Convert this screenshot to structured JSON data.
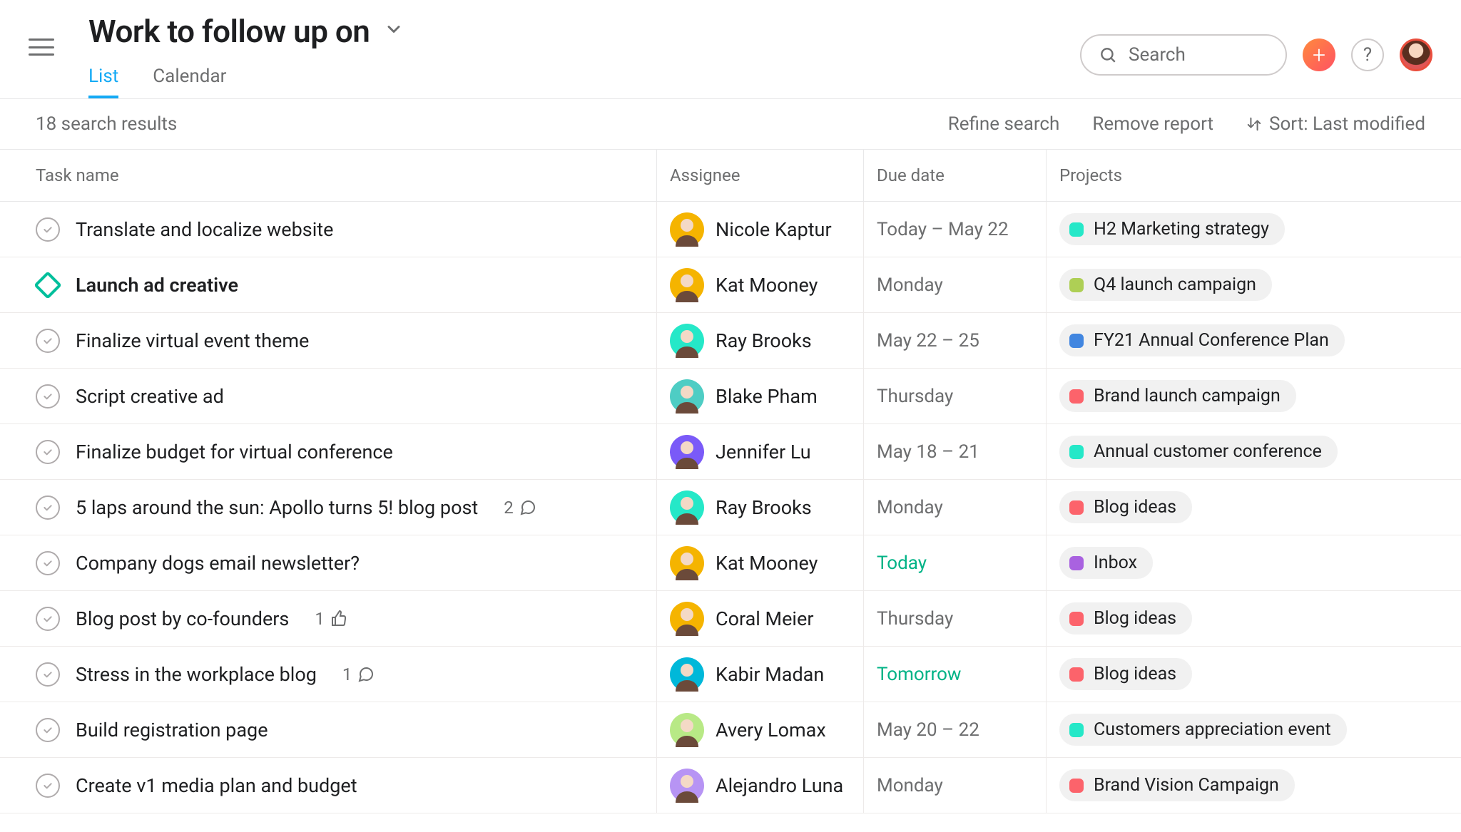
{
  "header": {
    "title": "Work to follow up on",
    "tabs": [
      {
        "label": "List",
        "active": true
      },
      {
        "label": "Calendar",
        "active": false
      }
    ],
    "search_placeholder": "Search"
  },
  "toolbar": {
    "result_count": "18 search results",
    "refine": "Refine search",
    "remove": "Remove report",
    "sort": "Sort: Last modified"
  },
  "columns": {
    "task": "Task name",
    "assignee": "Assignee",
    "due": "Due date",
    "projects": "Projects"
  },
  "project_colors": {
    "teal": "#25e8c8",
    "lime": "#aecf55",
    "blue": "#4186e0",
    "red": "#fc636b",
    "purple": "#a962e0"
  },
  "tasks": [
    {
      "name": "Translate and localize website",
      "milestone": false,
      "bold": false,
      "assignee": "Nicole Kaptur",
      "avatar_bg": "#f5b400",
      "due": "Today – May 22",
      "due_color": "grey",
      "project": {
        "name": "H2 Marketing strategy",
        "color": "teal"
      },
      "comments": null,
      "likes": null
    },
    {
      "name": "Launch ad creative",
      "milestone": true,
      "bold": true,
      "assignee": "Kat Mooney",
      "avatar_bg": "#f5b400",
      "due": "Monday",
      "due_color": "grey",
      "project": {
        "name": "Q4 launch campaign",
        "color": "lime"
      },
      "comments": null,
      "likes": null
    },
    {
      "name": "Finalize virtual event theme",
      "milestone": false,
      "bold": false,
      "assignee": "Ray Brooks",
      "avatar_bg": "#25e8c8",
      "due": "May 22 – 25",
      "due_color": "grey",
      "project": {
        "name": "FY21 Annual Conference Plan",
        "color": "blue"
      },
      "comments": null,
      "likes": null
    },
    {
      "name": "Script creative ad",
      "milestone": false,
      "bold": false,
      "assignee": "Blake Pham",
      "avatar_bg": "#4ecdc4",
      "due": "Thursday",
      "due_color": "grey",
      "project": {
        "name": "Brand launch campaign",
        "color": "red"
      },
      "comments": null,
      "likes": null
    },
    {
      "name": "Finalize budget for virtual conference",
      "milestone": false,
      "bold": false,
      "assignee": "Jennifer Lu",
      "avatar_bg": "#7a5af8",
      "due": "May 18 – 21",
      "due_color": "grey",
      "project": {
        "name": "Annual customer conference",
        "color": "teal"
      },
      "comments": null,
      "likes": null
    },
    {
      "name": "5 laps around the sun: Apollo turns 5! blog post",
      "milestone": false,
      "bold": false,
      "assignee": "Ray Brooks",
      "avatar_bg": "#25e8c8",
      "due": "Monday",
      "due_color": "grey",
      "project": {
        "name": "Blog ideas",
        "color": "red"
      },
      "comments": "2",
      "likes": null
    },
    {
      "name": "Company dogs email newsletter?",
      "milestone": false,
      "bold": false,
      "assignee": "Kat Mooney",
      "avatar_bg": "#f5b400",
      "due": "Today",
      "due_color": "green",
      "project": {
        "name": "Inbox",
        "color": "purple"
      },
      "comments": null,
      "likes": null
    },
    {
      "name": "Blog post by co-founders",
      "milestone": false,
      "bold": false,
      "assignee": "Coral Meier",
      "avatar_bg": "#f5b400",
      "due": "Thursday",
      "due_color": "grey",
      "project": {
        "name": "Blog ideas",
        "color": "red"
      },
      "comments": null,
      "likes": "1"
    },
    {
      "name": "Stress in the workplace blog",
      "milestone": false,
      "bold": false,
      "assignee": "Kabir Madan",
      "avatar_bg": "#00b8d9",
      "due": "Tomorrow",
      "due_color": "green",
      "project": {
        "name": "Blog ideas",
        "color": "red"
      },
      "comments": "1",
      "likes": null
    },
    {
      "name": "Build registration page",
      "milestone": false,
      "bold": false,
      "assignee": "Avery Lomax",
      "avatar_bg": "#b8e986",
      "due": "May 20 – 22",
      "due_color": "grey",
      "project": {
        "name": "Customers appreciation event",
        "color": "teal"
      },
      "comments": null,
      "likes": null
    },
    {
      "name": "Create v1 media plan and budget",
      "milestone": false,
      "bold": false,
      "assignee": "Alejandro Luna",
      "avatar_bg": "#b794f4",
      "due": "Monday",
      "due_color": "grey",
      "project": {
        "name": "Brand Vision Campaign",
        "color": "red"
      },
      "comments": null,
      "likes": null
    }
  ]
}
